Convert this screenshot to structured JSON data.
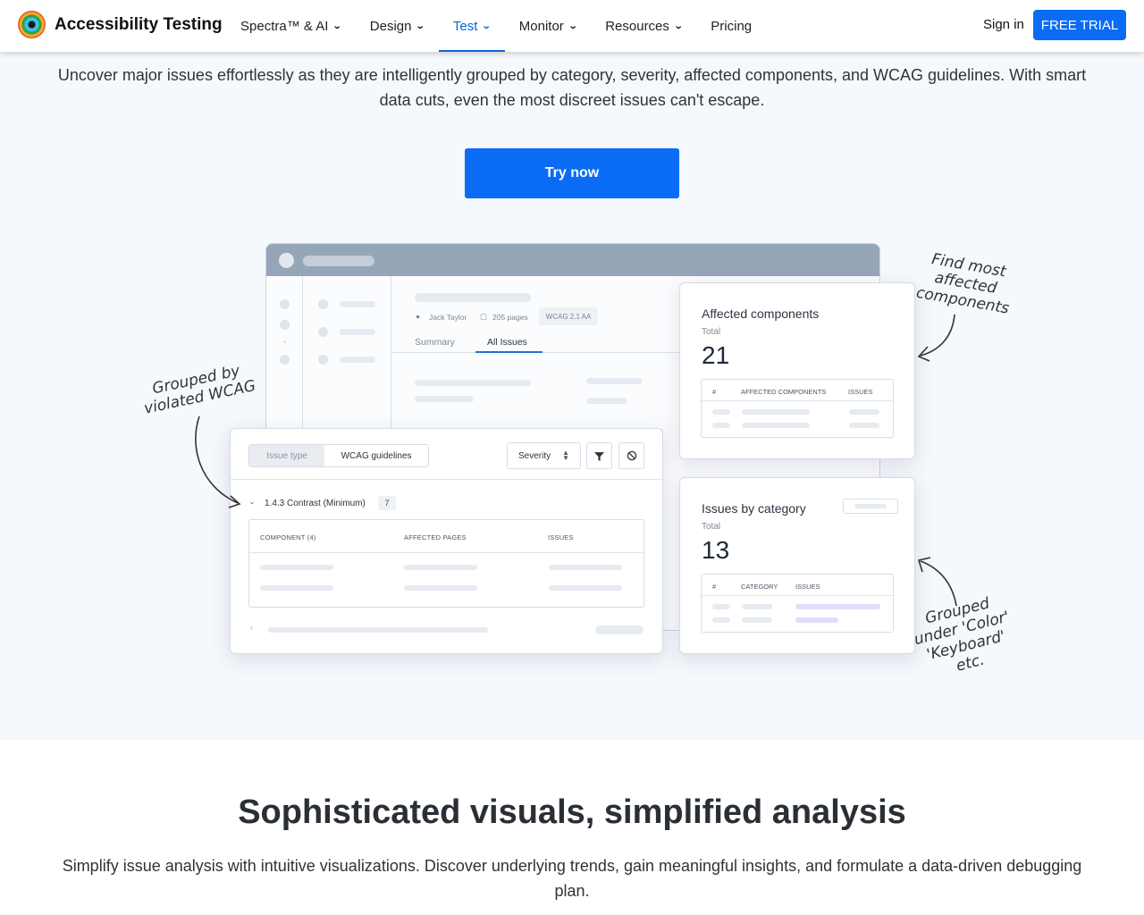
{
  "nav": {
    "brand": "Accessibility Testing",
    "items": [
      {
        "label": "Spectra™ & AI",
        "has_dropdown": true,
        "active": false
      },
      {
        "label": "Design",
        "has_dropdown": true,
        "active": false
      },
      {
        "label": "Test",
        "has_dropdown": true,
        "active": true
      },
      {
        "label": "Monitor",
        "has_dropdown": true,
        "active": false
      },
      {
        "label": "Resources",
        "has_dropdown": true,
        "active": false
      },
      {
        "label": "Pricing",
        "has_dropdown": false,
        "active": false
      }
    ],
    "signin": "Sign in",
    "trial": "FREE TRIAL"
  },
  "hero": {
    "description": "Uncover major issues effortlessly as they are intelligently grouped by category, severity, affected components, and WCAG guidelines. With smart data cuts, even the most discreet issues can't escape.",
    "cta": "Try now"
  },
  "illustration": {
    "report": {
      "user": "Jack Taylor",
      "pages": "205 pages",
      "standard": "WCAG 2.1 AA",
      "tabs": [
        "Summary",
        "All Issues"
      ],
      "active_tab": "All Issues"
    },
    "issues_panel": {
      "segments": [
        "Issue type",
        "WCAG guidelines"
      ],
      "active_segment": "WCAG guidelines",
      "severity_label": "Severity",
      "group_title": "1.4.3 Contrast (Minimum)",
      "group_count": "7",
      "columns": [
        "COMPONENT (4)",
        "AFFECTED PAGES",
        "ISSUES"
      ]
    },
    "affected_components": {
      "title": "Affected components",
      "total_label": "Total",
      "total": "21",
      "columns": [
        "#",
        "AFFECTED COMPONENTS",
        "ISSUES"
      ]
    },
    "issues_by_category": {
      "title": "Issues by category",
      "total_label": "Total",
      "total": "13",
      "columns": [
        "#",
        "CATEGORY",
        "ISSUES"
      ]
    },
    "annotations": {
      "wcag": "Grouped by\nviolated WCAG",
      "components": "Find most\naffected\ncomponents",
      "category": "Grouped\nunder 'Color'\n'Keyboard'\netc."
    },
    "colors": {
      "accent": "#0a6cf5",
      "highlight_bar": "#e4dcfb"
    }
  },
  "section2": {
    "title": "Sophisticated visuals, simplified analysis",
    "description": "Simplify issue analysis with intuitive visualizations. Discover underlying trends, gain meaningful insights, and formulate a data-driven debugging plan."
  }
}
